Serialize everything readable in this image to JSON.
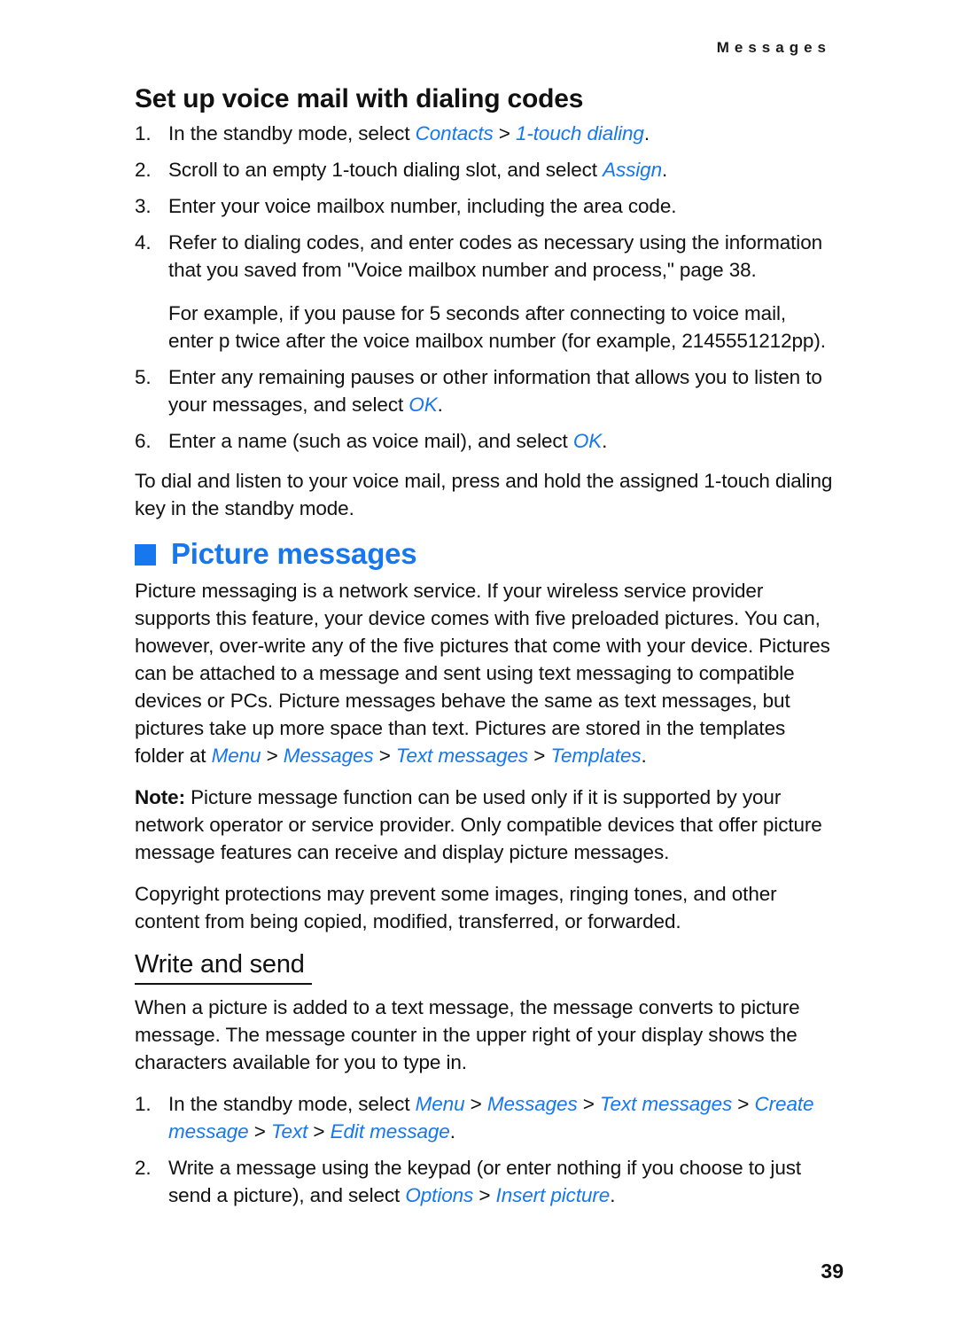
{
  "header": {
    "running_head": "Messages"
  },
  "sections": {
    "voicemail": {
      "heading": "Set up voice mail with dialing codes",
      "steps": [
        {
          "num": "1.",
          "parts": [
            {
              "t": "In the standby mode, select ",
              "s": "plain"
            },
            {
              "t": "Contacts",
              "s": "ui"
            },
            {
              "t": " > ",
              "s": "sep"
            },
            {
              "t": "1-touch dialing",
              "s": "ui"
            },
            {
              "t": ".",
              "s": "plain"
            }
          ]
        },
        {
          "num": "2.",
          "parts": [
            {
              "t": "Scroll to an empty 1-touch dialing slot, and select ",
              "s": "plain"
            },
            {
              "t": "Assign",
              "s": "ui"
            },
            {
              "t": ".",
              "s": "plain"
            }
          ]
        },
        {
          "num": "3.",
          "parts": [
            {
              "t": "Enter your voice mailbox number, including the area code.",
              "s": "plain"
            }
          ]
        },
        {
          "num": "4.",
          "parts": [
            {
              "t": "Refer to dialing codes, and enter codes as necessary using the information that you saved from \"Voice mailbox number and process,\" page 38.",
              "s": "plain"
            }
          ],
          "sub": "For example, if you pause for 5 seconds after connecting to voice mail, enter p twice after the voice mailbox number (for example, 2145551212pp)."
        },
        {
          "num": "5.",
          "parts": [
            {
              "t": "Enter any remaining pauses or other information that allows you to listen to your messages, and select ",
              "s": "plain"
            },
            {
              "t": "OK",
              "s": "ui"
            },
            {
              "t": ".",
              "s": "plain"
            }
          ]
        },
        {
          "num": "6.",
          "parts": [
            {
              "t": "Enter a name (such as voice mail), and select ",
              "s": "plain"
            },
            {
              "t": "OK",
              "s": "ui"
            },
            {
              "t": ".",
              "s": "plain"
            }
          ]
        }
      ],
      "closing_paragraph": "To dial and listen to your voice mail, press and hold the assigned 1-touch dialing key in the standby mode."
    },
    "picture_messages": {
      "heading": "Picture messages",
      "bullet_icon": "square-bullet",
      "intro_parts": [
        {
          "t": "Picture messaging is a network service. If your wireless service provider supports this feature, your device comes with five preloaded pictures. You can, however, over-write any of the five pictures that come with your device. Pictures can be attached to a message and sent using text messaging to compatible devices or PCs. Picture messages behave the same as text messages, but pictures take up more space than text. Pictures are stored in the templates folder at ",
          "s": "plain"
        },
        {
          "t": "Menu",
          "s": "ui"
        },
        {
          "t": " > ",
          "s": "sep"
        },
        {
          "t": "Messages",
          "s": "ui"
        },
        {
          "t": " > ",
          "s": "sep"
        },
        {
          "t": "Text messages",
          "s": "ui"
        },
        {
          "t": " > ",
          "s": "sep"
        },
        {
          "t": "Templates",
          "s": "ui"
        },
        {
          "t": ".",
          "s": "plain"
        }
      ],
      "note_parts": [
        {
          "t": "Note:",
          "s": "bold"
        },
        {
          "t": "  Picture message function can be used only if it is supported by your network operator or service provider. Only compatible devices that offer picture message features can receive and display picture messages.",
          "s": "plain"
        }
      ],
      "copyright_paragraph": "Copyright protections may prevent some images, ringing tones, and other content from being copied, modified, transferred, or forwarded."
    },
    "write_and_send": {
      "heading": "Write and send",
      "intro_paragraph": "When a picture is added to a text message, the message converts to picture message. The message counter in the upper right of your display shows the characters available for you to type in.",
      "steps": [
        {
          "num": "1.",
          "parts": [
            {
              "t": "In the standby mode, select ",
              "s": "plain"
            },
            {
              "t": "Menu",
              "s": "ui"
            },
            {
              "t": " > ",
              "s": "sep"
            },
            {
              "t": "Messages",
              "s": "ui"
            },
            {
              "t": " > ",
              "s": "sep"
            },
            {
              "t": "Text messages",
              "s": "ui"
            },
            {
              "t": " > ",
              "s": "sep"
            },
            {
              "t": "Create message",
              "s": "ui"
            },
            {
              "t": " > ",
              "s": "sep"
            },
            {
              "t": "Text",
              "s": "ui"
            },
            {
              "t": " > ",
              "s": "sep"
            },
            {
              "t": "Edit message",
              "s": "ui"
            },
            {
              "t": ".",
              "s": "plain"
            }
          ]
        },
        {
          "num": "2.",
          "parts": [
            {
              "t": "Write a message using the keypad (or enter nothing if you choose to just send a picture), and select ",
              "s": "plain"
            },
            {
              "t": "Options",
              "s": "ui"
            },
            {
              "t": " > ",
              "s": "sep"
            },
            {
              "t": "Insert picture",
              "s": "ui"
            },
            {
              "t": ".",
              "s": "plain"
            }
          ]
        }
      ]
    }
  },
  "footer": {
    "page_number": "39"
  },
  "colors": {
    "link_blue": "#1677ef",
    "body_black": "#111111"
  }
}
